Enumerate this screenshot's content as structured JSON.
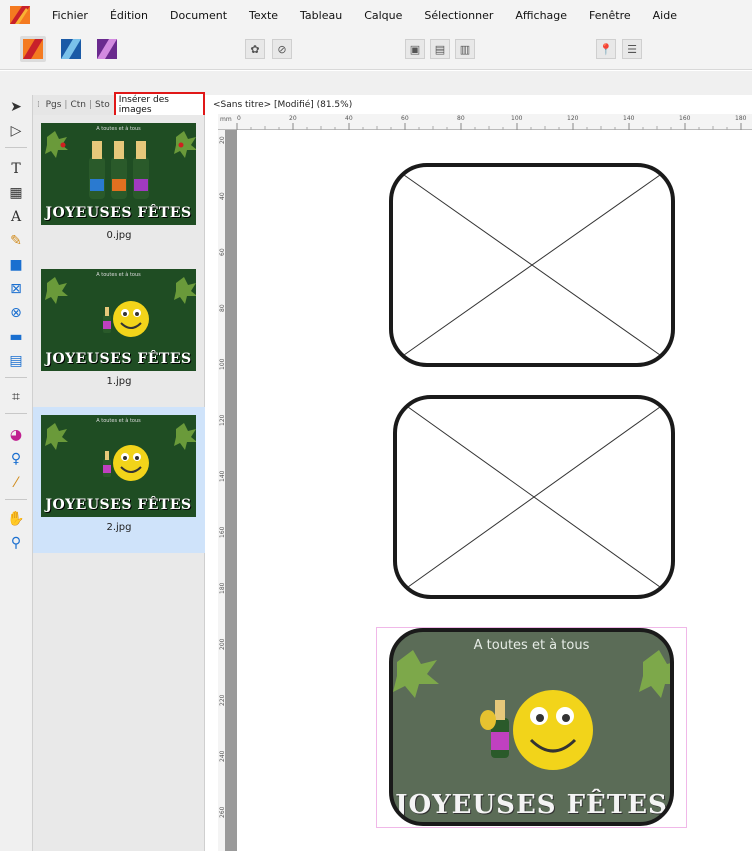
{
  "menu": {
    "items": [
      "Fichier",
      "Édition",
      "Document",
      "Texte",
      "Tableau",
      "Calque",
      "Sélectionner",
      "Affichage",
      "Fenêtre",
      "Aide"
    ]
  },
  "panel": {
    "tabs": [
      "Pgs",
      "Ctn",
      "Sto"
    ],
    "active_tab": "Insérer des images",
    "assets": [
      {
        "name": "0.jpg",
        "caption": "A toutes et à tous",
        "banner": "JOYEUSES FÊTES"
      },
      {
        "name": "1.jpg",
        "caption": "A toutes et à tous",
        "banner": "JOYEUSES FÊTES"
      },
      {
        "name": "2.jpg",
        "caption": "A toutes et à tous",
        "banner": "JOYEUSES FÊTES"
      }
    ]
  },
  "document": {
    "tab_label": "<Sans titre> [Modifié] (81.5%)",
    "ruler_unit": "mm",
    "ruler_top_labels": [
      "0",
      "20",
      "40",
      "60",
      "80",
      "100",
      "120",
      "140",
      "160",
      "180"
    ],
    "ruler_left_labels": [
      "20",
      "40",
      "60",
      "80",
      "100",
      "120",
      "140",
      "160",
      "180",
      "200",
      "220",
      "240",
      "260"
    ],
    "placed_image": {
      "caption": "A toutes et à tous",
      "banner": "JOYEUSES FÊTES"
    }
  },
  "colors": {
    "highlight": "#e01818",
    "selection": "#cfe3fa",
    "card_green": "#1f4d23",
    "placed_bg": "#5b6c57"
  }
}
